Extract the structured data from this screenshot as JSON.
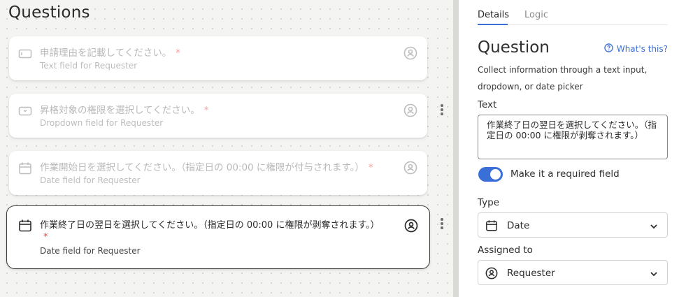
{
  "canvas": {
    "title": "Questions",
    "cards": [
      {
        "title": "申請理由を記載してください。",
        "required_mark": "*",
        "subtitle": "Text field for Requester",
        "icon": "text-field-icon",
        "active": false
      },
      {
        "title": "昇格対象の権限を選択してください。",
        "required_mark": "*",
        "subtitle": "Dropdown field for Requester",
        "icon": "dropdown-field-icon",
        "active": false
      },
      {
        "title": "作業開始日を選択してください。（指定日の 00:00 に権限が付与されます。）",
        "required_mark": "*",
        "subtitle": "Date field for Requester",
        "icon": "calendar-icon",
        "active": false
      },
      {
        "title": "作業終了日の翌日を選択してください。（指定日の 00:00 に権限が剥奪されます。）",
        "required_mark": "*",
        "subtitle": "Date field for Requester",
        "icon": "calendar-icon",
        "active": true
      }
    ]
  },
  "panel": {
    "tabs": [
      {
        "label": "Details",
        "active": true
      },
      {
        "label": "Logic",
        "active": false
      }
    ],
    "title": "Question",
    "help_link": "What's this?",
    "description": "Collect information through a text input, dropdown, or date picker",
    "text_label": "Text",
    "text_value": "作業終了日の翌日を選択してください。（指定日の 00:00 に権限が剥奪されます。）",
    "required_toggle": {
      "label": "Make it a required field",
      "on": true
    },
    "type_label": "Type",
    "type_value": "Date",
    "assigned_label": "Assigned to",
    "assigned_value": "Requester"
  },
  "colors": {
    "accent": "#3b6fd8",
    "required_star": "#e04a4a",
    "canvas_bg": "#f4f4f2"
  }
}
